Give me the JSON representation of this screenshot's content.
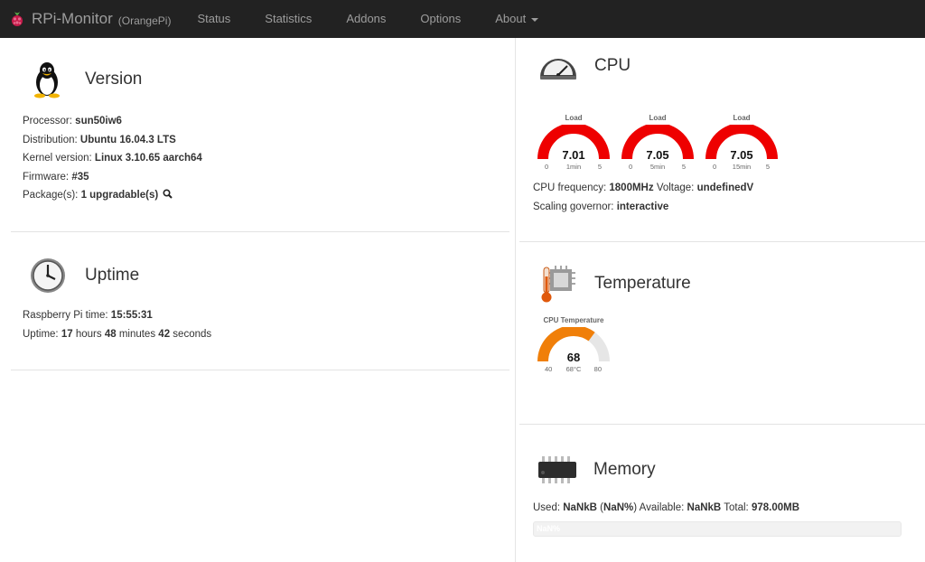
{
  "navbar": {
    "brand": "RPi-Monitor",
    "host": "(OrangePi)",
    "items": [
      {
        "label": "Status"
      },
      {
        "label": "Statistics"
      },
      {
        "label": "Addons"
      },
      {
        "label": "Options"
      },
      {
        "label": "About"
      }
    ],
    "icons": {
      "logo": "raspberry-icon",
      "about": "caret-down-icon"
    }
  },
  "version": {
    "title": "Version",
    "icon": "tux-penguin-icon",
    "processor_label": "Processor:",
    "processor": "sun50iw6",
    "distribution_label": "Distribution:",
    "distribution": "Ubuntu 16.04.3 LTS",
    "kernel_label": "Kernel version:",
    "kernel": "Linux 3.10.65 aarch64",
    "firmware_label": "Firmware:",
    "firmware": "#35",
    "packages_label": "Package(s):",
    "packages": "1 upgradable(s)",
    "packages_icon": "search-icon"
  },
  "uptime": {
    "title": "Uptime",
    "icon": "clock-icon",
    "time_label": "Raspberry Pi time:",
    "time": "15:55:31",
    "uptime_label": "Uptime:",
    "hours": "17",
    "hours_unit": "hours",
    "minutes": "48",
    "minutes_unit": "minutes",
    "seconds": "42",
    "seconds_unit": "seconds"
  },
  "cpu": {
    "title": "CPU",
    "icon": "speedometer-icon",
    "gauges": [
      {
        "title": "Load",
        "value": "7.01",
        "min": "0",
        "max": "5",
        "unit": "1min",
        "level": 1.0
      },
      {
        "title": "Load",
        "value": "7.05",
        "min": "0",
        "max": "5",
        "unit": "5min",
        "level": 1.0
      },
      {
        "title": "Load",
        "value": "7.05",
        "min": "0",
        "max": "5",
        "unit": "15min",
        "level": 1.0
      }
    ],
    "freq_label": "CPU frequency:",
    "freq": "1800MHz",
    "voltage_label": "Voltage:",
    "voltage": "undefinedV",
    "governor_label": "Scaling governor:",
    "governor": "interactive",
    "gauge_color": "#ee0000"
  },
  "temperature": {
    "title": "Temperature",
    "icon": "thermometer-chip-icon",
    "gauge": {
      "title": "CPU Temperature",
      "value": "68",
      "min": "40",
      "max": "80",
      "unit": "68°C",
      "level": 0.7
    },
    "gauge_color": "#f07f09"
  },
  "memory": {
    "title": "Memory",
    "icon": "memory-chip-icon",
    "used_label": "Used:",
    "used": "NaNkB",
    "used_pct_open": "(",
    "used_pct": "NaN%",
    "used_pct_close": ")",
    "available_label": "Available:",
    "available": "NaNkB",
    "total_label": "Total:",
    "total": "978.00MB",
    "bar_label": "NaN%"
  }
}
